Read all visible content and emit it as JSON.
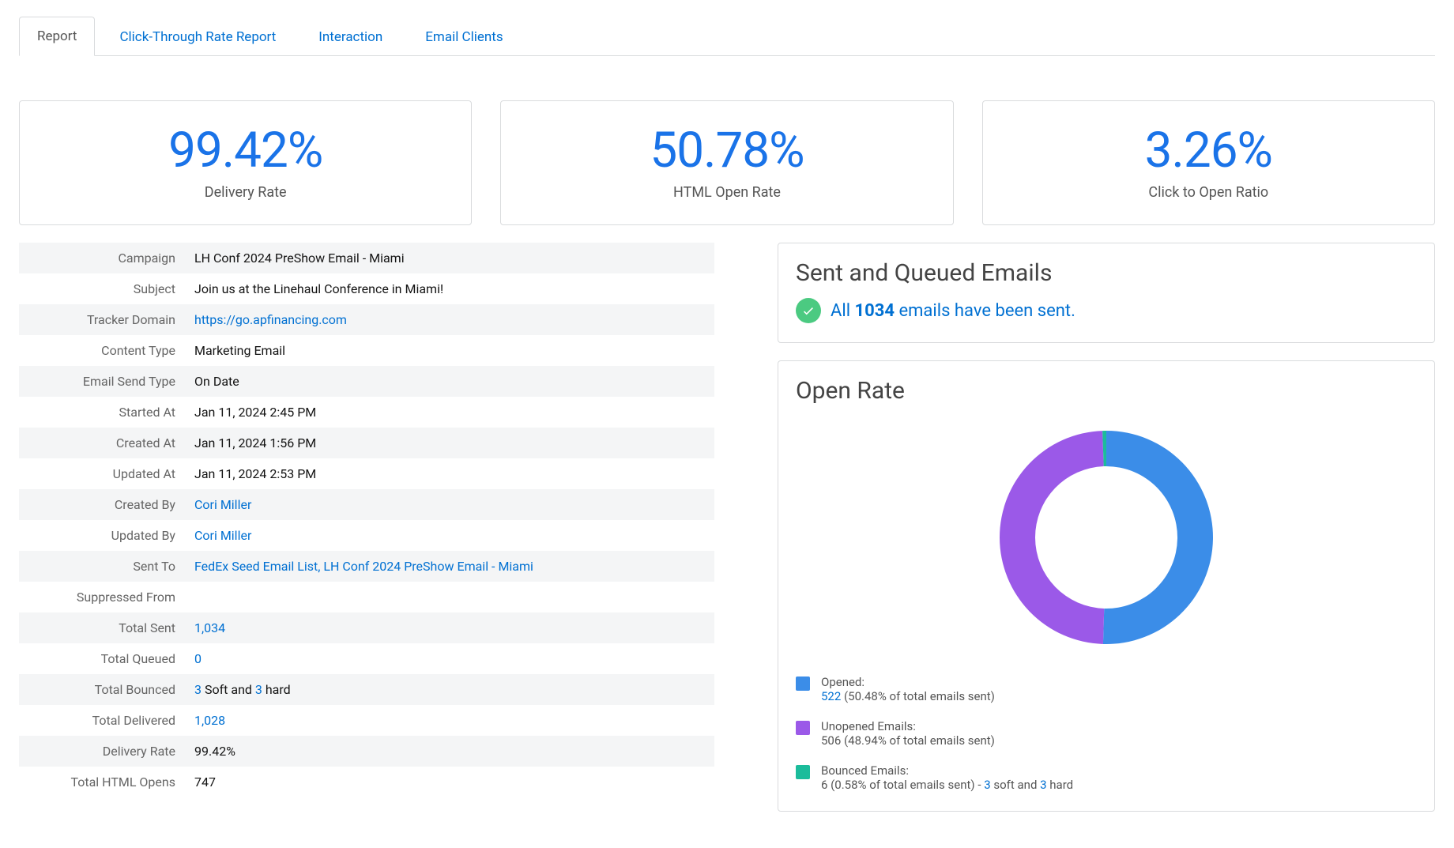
{
  "tabs": {
    "report": "Report",
    "ctr": "Click-Through Rate Report",
    "interaction": "Interaction",
    "clients": "Email Clients"
  },
  "metrics": {
    "delivery_rate": {
      "value": "99.42%",
      "label": "Delivery Rate"
    },
    "open_rate": {
      "value": "50.78%",
      "label": "HTML Open Rate"
    },
    "cto_ratio": {
      "value": "3.26%",
      "label": "Click to Open Ratio"
    }
  },
  "details": {
    "campaign": {
      "label": "Campaign",
      "value": "LH Conf 2024 PreShow Email - Miami"
    },
    "subject": {
      "label": "Subject",
      "value": "Join us at the Linehaul Conference in Miami!"
    },
    "tracker_domain": {
      "label": "Tracker Domain",
      "value": "https://go.apfinancing.com"
    },
    "content_type": {
      "label": "Content Type",
      "value": "Marketing Email"
    },
    "email_send_type": {
      "label": "Email Send Type",
      "value": "On Date"
    },
    "started_at": {
      "label": "Started At",
      "value": "Jan 11, 2024 2:45 PM"
    },
    "created_at": {
      "label": "Created At",
      "value": "Jan 11, 2024 1:56 PM"
    },
    "updated_at": {
      "label": "Updated At",
      "value": "Jan 11, 2024 2:53 PM"
    },
    "created_by": {
      "label": "Created By",
      "value": "Cori Miller"
    },
    "updated_by": {
      "label": "Updated By",
      "value": "Cori Miller"
    },
    "sent_to": {
      "label": "Sent To",
      "value": "FedEx Seed Email List, LH Conf 2024 PreShow Email - Miami"
    },
    "suppressed_from": {
      "label": "Suppressed From",
      "value": ""
    },
    "total_sent": {
      "label": "Total Sent",
      "value": "1,034"
    },
    "total_queued": {
      "label": "Total Queued",
      "value": "0"
    },
    "total_bounced": {
      "label": "Total Bounced",
      "soft": "3",
      "soft_suffix": " Soft and ",
      "hard": "3",
      "hard_suffix": " hard"
    },
    "total_delivered": {
      "label": "Total Delivered",
      "value": "1,028"
    },
    "delivery_rate": {
      "label": "Delivery Rate",
      "value": "99.42%"
    },
    "total_html_opens": {
      "label": "Total HTML Opens",
      "value": "747"
    }
  },
  "sent_panel": {
    "title": "Sent and Queued Emails",
    "pre": "All ",
    "count": "1034",
    "post": " emails have been sent."
  },
  "open_rate_panel": {
    "title": "Open Rate",
    "legend": {
      "opened": {
        "title": "Opened:",
        "count": "522",
        "detail": " (50.48% of total emails sent)"
      },
      "unopened": {
        "title": "Unopened Emails:",
        "count": "506",
        "detail": " (48.94% of total emails sent)"
      },
      "bounced": {
        "title": "Bounced Emails:",
        "count_text": "6 (0.58% of total emails sent) - ",
        "soft": "3",
        "soft_suffix": " soft and ",
        "hard": "3",
        "hard_suffix": " hard"
      }
    }
  },
  "colors": {
    "blue": "#3b8de8",
    "purple": "#9b59e8",
    "green": "#1bbc9b"
  },
  "chart_data": {
    "type": "pie",
    "title": "Open Rate",
    "categories": [
      "Opened",
      "Unopened Emails",
      "Bounced Emails"
    ],
    "values": [
      522,
      506,
      6
    ],
    "percentages": [
      50.48,
      48.94,
      0.58
    ],
    "colors": [
      "#3b8de8",
      "#9b59e8",
      "#1bbc9b"
    ],
    "donut": true
  }
}
